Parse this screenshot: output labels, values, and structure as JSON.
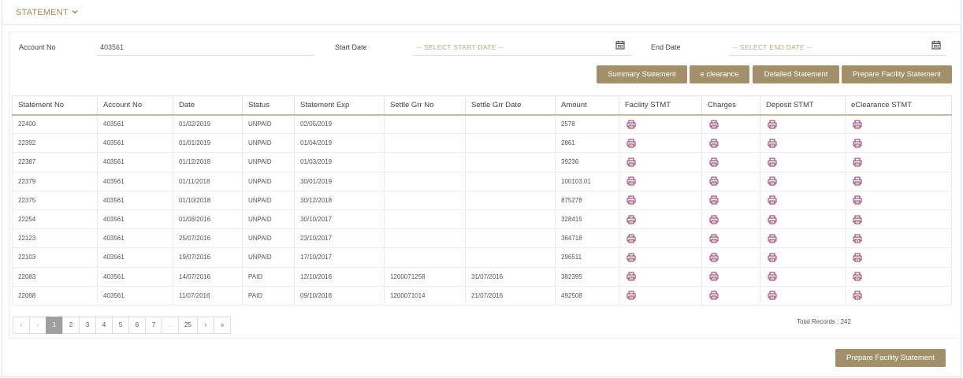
{
  "section": {
    "title": "STATEMENT"
  },
  "filters": {
    "account_label": "Account No",
    "account_value": "403561",
    "start_label": "Start Date",
    "start_placeholder": "-- SELECT START DATE --",
    "end_label": "End Date",
    "end_placeholder": "-- SELECT END DATE --"
  },
  "actions": {
    "summary": "Summary Statement",
    "eclearance": "e clearance",
    "detailed": "Detailed Statement",
    "prepare": "Prepare Facility Statement"
  },
  "table": {
    "headers": [
      "Statement No",
      "Account No",
      "Date",
      "Status",
      "Statement Exp",
      "Settle Grr No",
      "Settle Grr Date",
      "Amount",
      "Facility STMT",
      "Charges",
      "Deposit STMT",
      "eClearance STMT"
    ],
    "rows": [
      [
        "22400",
        "403561",
        "01/02/2019",
        "UNPAID",
        "02/05/2019",
        "",
        "",
        "2578"
      ],
      [
        "22392",
        "403561",
        "01/01/2019",
        "UNPAID",
        "01/04/2019",
        "",
        "",
        "2861"
      ],
      [
        "22387",
        "403561",
        "01/12/2018",
        "UNPAID",
        "01/03/2019",
        "",
        "",
        "39236"
      ],
      [
        "22379",
        "403561",
        "01/11/2018",
        "UNPAID",
        "30/01/2019",
        "",
        "",
        "100103.01"
      ],
      [
        "22375",
        "403561",
        "01/10/2018",
        "UNPAID",
        "30/12/2018",
        "",
        "",
        "875278"
      ],
      [
        "22254",
        "403561",
        "01/08/2016",
        "UNPAID",
        "30/10/2017",
        "",
        "",
        "328415"
      ],
      [
        "22123",
        "403561",
        "25/07/2016",
        "UNPAID",
        "23/10/2017",
        "",
        "",
        "364718"
      ],
      [
        "22103",
        "403561",
        "19/07/2016",
        "UNPAID",
        "17/10/2017",
        "",
        "",
        "296511"
      ],
      [
        "22083",
        "403561",
        "14/07/2016",
        "PAID",
        "12/10/2016",
        "1200071258",
        "31/07/2016",
        "382395"
      ],
      [
        "22068",
        "403561",
        "11/07/2016",
        "PAID",
        "09/10/2016",
        "1200071014",
        "21/07/2016",
        "492508"
      ]
    ],
    "row_icon": "printer-icon"
  },
  "pagination": {
    "first": "«",
    "prev": "‹",
    "pages": [
      "1",
      "2",
      "3",
      "4",
      "5",
      "6",
      "7",
      "...",
      "25"
    ],
    "active": "1",
    "next": "›",
    "last": "»",
    "total_records": "Total Records : 242"
  },
  "footer": {
    "prepare": "Prepare Facility Statement"
  },
  "colors": {
    "accent": "#a1906a",
    "title": "#a08c5b",
    "icon": "#8e2d5a"
  }
}
